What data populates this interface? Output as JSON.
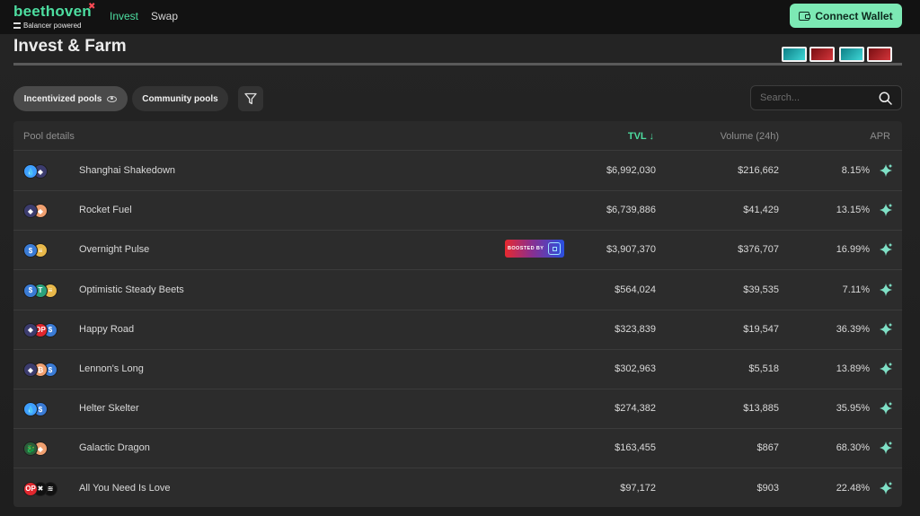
{
  "brand": {
    "name": "beethoven",
    "tagline": "Balancer powered",
    "accent": "#4ddda0"
  },
  "nav": {
    "links": [
      {
        "label": "Invest",
        "active": true
      },
      {
        "label": "Swap",
        "active": false
      }
    ],
    "connect_wallet_label": "Connect Wallet"
  },
  "page": {
    "title": "Invest & Farm"
  },
  "filters": {
    "incentivized_label": "Incentivized pools",
    "community_label": "Community pools",
    "search_placeholder": "Search..."
  },
  "table": {
    "headers": {
      "pool": "Pool details",
      "tvl": "TVL",
      "volume": "Volume (24h)",
      "apr": "APR"
    },
    "sort_column": "TVL",
    "sort_direction": "descending",
    "boosted_label": "BOOSTED BY",
    "rows": [
      {
        "name": "Shanghai Shakedown",
        "tvl": "$6,992,030",
        "volume": "$216,662",
        "apr": "8.15%",
        "tokens": [
          {
            "color": "#3f9fff",
            "glyph": "💧"
          },
          {
            "color": "#3c3c6e",
            "glyph": "◆"
          }
        ]
      },
      {
        "name": "Rocket Fuel",
        "tvl": "$6,739,886",
        "volume": "$41,429",
        "apr": "13.15%",
        "tokens": [
          {
            "color": "#3c3c6e",
            "glyph": "◆"
          },
          {
            "color": "#f0a070",
            "glyph": "◆"
          }
        ]
      },
      {
        "name": "Overnight Pulse",
        "tvl": "$3,907,370",
        "volume": "$376,707",
        "apr": "16.99%",
        "boosted": true,
        "tokens": [
          {
            "color": "#3a7bd5",
            "glyph": "$"
          },
          {
            "color": "#e8b84a",
            "glyph": "≡"
          }
        ]
      },
      {
        "name": "Optimistic Steady Beets",
        "tvl": "$564,024",
        "volume": "$39,535",
        "apr": "7.11%",
        "tokens": [
          {
            "color": "#3a7bd5",
            "glyph": "$"
          },
          {
            "color": "#2aa17c",
            "glyph": "T"
          },
          {
            "color": "#e8b84a",
            "glyph": "≡"
          }
        ]
      },
      {
        "name": "Happy Road",
        "tvl": "$323,839",
        "volume": "$19,547",
        "apr": "36.39%",
        "tokens": [
          {
            "color": "#3c3c6e",
            "glyph": "◆"
          },
          {
            "color": "#e0272e",
            "glyph": "OP"
          },
          {
            "color": "#3a7bd5",
            "glyph": "$"
          }
        ]
      },
      {
        "name": "Lennon's Long",
        "tvl": "$302,963",
        "volume": "$5,518",
        "apr": "13.89%",
        "tokens": [
          {
            "color": "#3c3c6e",
            "glyph": "◆"
          },
          {
            "color": "#f0a070",
            "glyph": "₿"
          },
          {
            "color": "#3a7bd5",
            "glyph": "$"
          }
        ]
      },
      {
        "name": "Helter Skelter",
        "tvl": "$274,382",
        "volume": "$13,885",
        "apr": "35.95%",
        "tokens": [
          {
            "color": "#3f9fff",
            "glyph": "💧"
          },
          {
            "color": "#3a7bd5",
            "glyph": "$"
          }
        ]
      },
      {
        "name": "Galactic Dragon",
        "tvl": "$163,455",
        "volume": "$867",
        "apr": "68.30%",
        "tokens": [
          {
            "color": "#2b5e3a",
            "glyph": "🐉"
          },
          {
            "color": "#f0a070",
            "glyph": "◆"
          }
        ]
      },
      {
        "name": "All You Need Is Love",
        "tvl": "$97,172",
        "volume": "$903",
        "apr": "22.48%",
        "tokens": [
          {
            "color": "#e0272e",
            "glyph": "OP"
          },
          {
            "color": "#111111",
            "glyph": "✖"
          },
          {
            "color": "#111111",
            "glyph": "≋"
          }
        ]
      }
    ]
  }
}
